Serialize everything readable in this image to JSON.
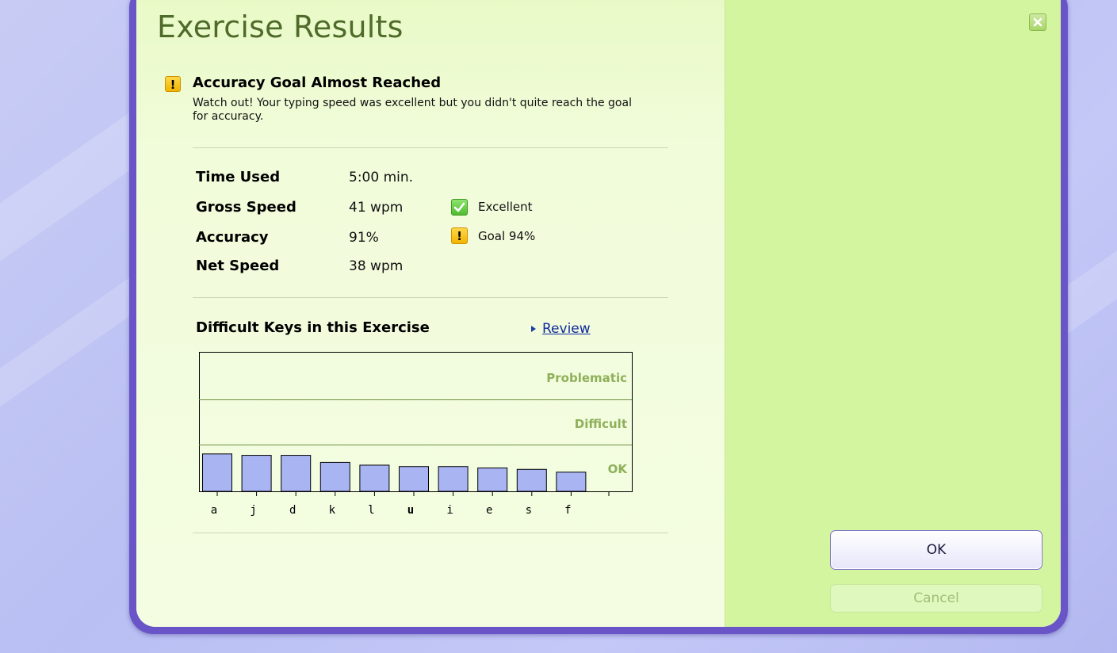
{
  "dialog": {
    "title": "Exercise Results",
    "status_title": "Accuracy Goal Almost Reached",
    "status_text": "Watch out! Your typing speed was excellent but you didn't quite reach the goal for accuracy.",
    "status_icon": "warning-icon"
  },
  "stats": [
    {
      "label": "Time Used",
      "value": "5:00 min.",
      "note": "",
      "icon": ""
    },
    {
      "label": "Gross Speed",
      "value": "41 wpm",
      "note": "Excellent",
      "icon": "check-icon"
    },
    {
      "label": "Accuracy",
      "value": "91%",
      "note": "Goal 94%",
      "icon": "warning-icon"
    },
    {
      "label": "Net Speed",
      "value": "38 wpm",
      "note": "",
      "icon": ""
    }
  ],
  "difficult_keys": {
    "title": "Difficult Keys in this Exercise",
    "review_label": "Review"
  },
  "chart_data": {
    "type": "bar",
    "categories": [
      "a",
      "j",
      "d",
      "k",
      "l",
      "u",
      "i",
      "e",
      "s",
      "f"
    ],
    "bold_categories": [
      "u"
    ],
    "values": [
      0.8,
      0.77,
      0.77,
      0.62,
      0.56,
      0.53,
      0.53,
      0.5,
      0.47,
      0.41
    ],
    "value_unit": "fraction of OK band",
    "bands": [
      "Problematic",
      "Difficult",
      "OK"
    ],
    "bar_color": "#a9b4f3",
    "band_label_color": "#8fb05a"
  },
  "buttons": {
    "ok": "OK",
    "cancel": "Cancel"
  }
}
